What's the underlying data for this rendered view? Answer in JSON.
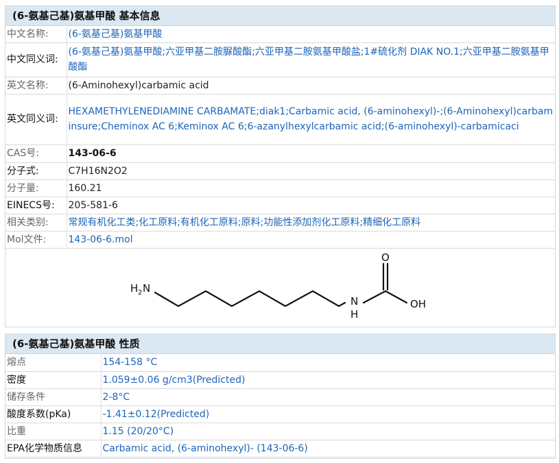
{
  "basic": {
    "title": "(6-氨基己基)氨基甲酸 基本信息",
    "rows": [
      {
        "label": "中文名称:",
        "value": "(6-氨基己基)氨基甲酸"
      },
      {
        "label": "中文同义词:",
        "value": "(6-氨基己基)氨基甲酸;六亚甲基二胺脲酸酯;六亚甲基二胺氨基甲酸盐;1#硫化剂 DIAK NO.1;六亚甲基二胺氨基甲酸酯"
      },
      {
        "label": "英文名称:",
        "value": "(6-Aminohexyl)carbamic acid"
      },
      {
        "label": "英文同义词:",
        "value": "HEXAMETHYLENEDIAMINE CARBAMATE;diak1;Carbamic acid, (6-aminohexyl)-;(6-Aminohexyl)carbaminsure;Cheminox AC 6;Keminox AC 6;6-azanylhexylcarbamic acid;(6-aminohexyl)-carbamicaci"
      },
      {
        "label": "CAS号:",
        "value": "143-06-6"
      },
      {
        "label": "分子式:",
        "value": "C7H16N2O2"
      },
      {
        "label": "分子量:",
        "value": "160.21"
      },
      {
        "label": "EINECS号:",
        "value": "205-581-6"
      },
      {
        "label": "相关类别:",
        "value": "常规有机化工类;化工原料;有机化工原料;原料;功能性添加剂化工原料;精细化工原料"
      },
      {
        "label": "Mol文件:",
        "value": "143-06-6.mol"
      }
    ],
    "structure": {
      "h2n": "H",
      "sub2": "2",
      "n": "N",
      "h": "H",
      "o": "O",
      "oh": "OH"
    }
  },
  "props": {
    "title": "(6-氨基己基)氨基甲酸 性质",
    "rows": [
      {
        "label": "熔点",
        "value": "154-158 °C"
      },
      {
        "label": "密度",
        "value": "1.059±0.06 g/cm3(Predicted)"
      },
      {
        "label": "储存条件",
        "value": "2-8°C"
      },
      {
        "label": "酸度系数(pKa)",
        "value": "-1.41±0.12(Predicted)"
      },
      {
        "label": "比重",
        "value": "1.15 (20/20°C)"
      },
      {
        "label": "EPA化学物质信息",
        "value": "Carbamic acid, (6-aminohexyl)- (143-06-6)"
      }
    ]
  },
  "colors": {
    "link": "#1c64b9",
    "header_bg": "#dbe7f1"
  }
}
